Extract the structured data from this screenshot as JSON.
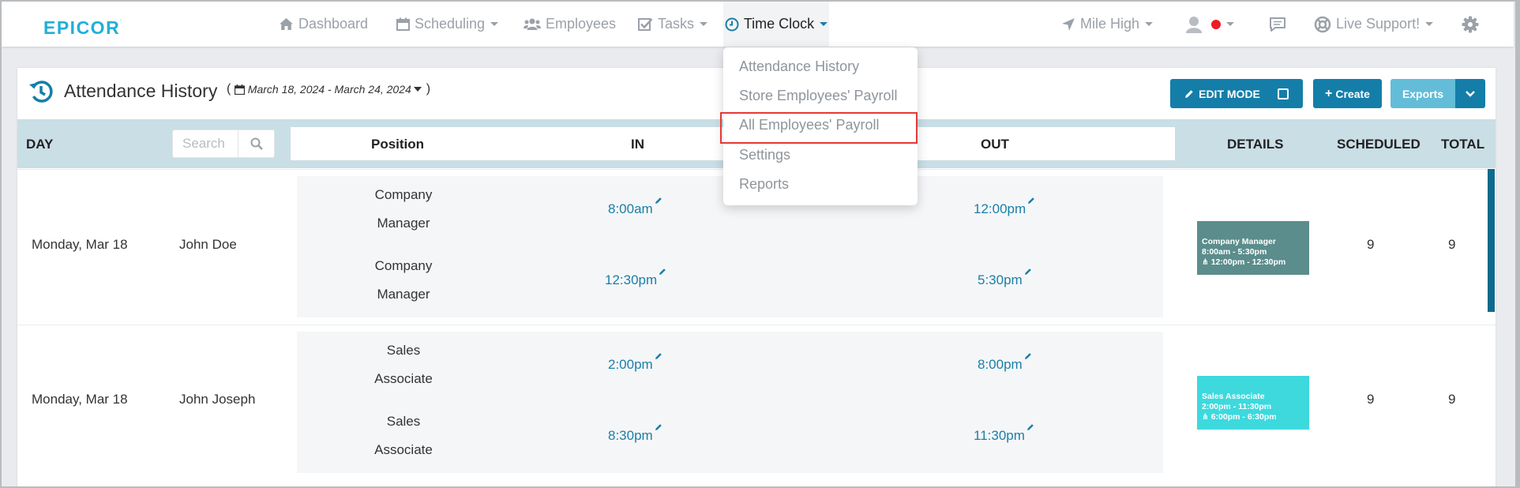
{
  "brand": {
    "logo_text": "EPICOR"
  },
  "nav": {
    "dashboard": "Dashboard",
    "scheduling": "Scheduling",
    "employees": "Employees",
    "tasks": "Tasks",
    "time_clock": "Time Clock",
    "location": "Mile High",
    "live_support": "Live Support!"
  },
  "time_clock_menu": {
    "items": [
      "Attendance History",
      "Store Employees' Payroll",
      "All Employees' Payroll",
      "Settings",
      "Reports"
    ],
    "highlighted": "All Employees' Payroll"
  },
  "page": {
    "title": "Attendance History",
    "date_range": "March 18, 2024 - March 24, 2024"
  },
  "toolbar": {
    "edit_mode": "EDIT MODE",
    "create": "Create",
    "exports": "Exports"
  },
  "table": {
    "headers": {
      "day": "DAY",
      "position": "Position",
      "in": "IN",
      "out": "OUT",
      "details": "DETAILS",
      "scheduled": "SCHEDULED",
      "total": "TOTAL"
    },
    "search_placeholder": "Search",
    "rows": [
      {
        "day": "Monday, Mar 18",
        "name": "John Doe",
        "shifts": [
          {
            "pos1": "Company",
            "pos2": "Manager",
            "in": "8:00am",
            "out": "12:00pm"
          },
          {
            "pos1": "Company",
            "pos2": "Manager",
            "in": "12:30pm",
            "out": "5:30pm"
          }
        ],
        "details": {
          "line1": "Company Manager",
          "line2": "8:00am - 5:30pm",
          "line3": "12:00pm - 12:30pm",
          "color": "#5b8d8c"
        },
        "scheduled": "9",
        "total": "9"
      },
      {
        "day": "Monday, Mar 18",
        "name": "John Joseph",
        "shifts": [
          {
            "pos1": "Sales",
            "pos2": "Associate",
            "in": "2:00pm",
            "out": "8:00pm"
          },
          {
            "pos1": "Sales",
            "pos2": "Associate",
            "in": "8:30pm",
            "out": "11:30pm"
          }
        ],
        "details": {
          "line1": "Sales Associate",
          "line2": "2:00pm - 11:30pm",
          "line3": "6:00pm - 6:30pm",
          "color": "#3dd9dd"
        },
        "scheduled": "9",
        "total": "9"
      }
    ]
  }
}
